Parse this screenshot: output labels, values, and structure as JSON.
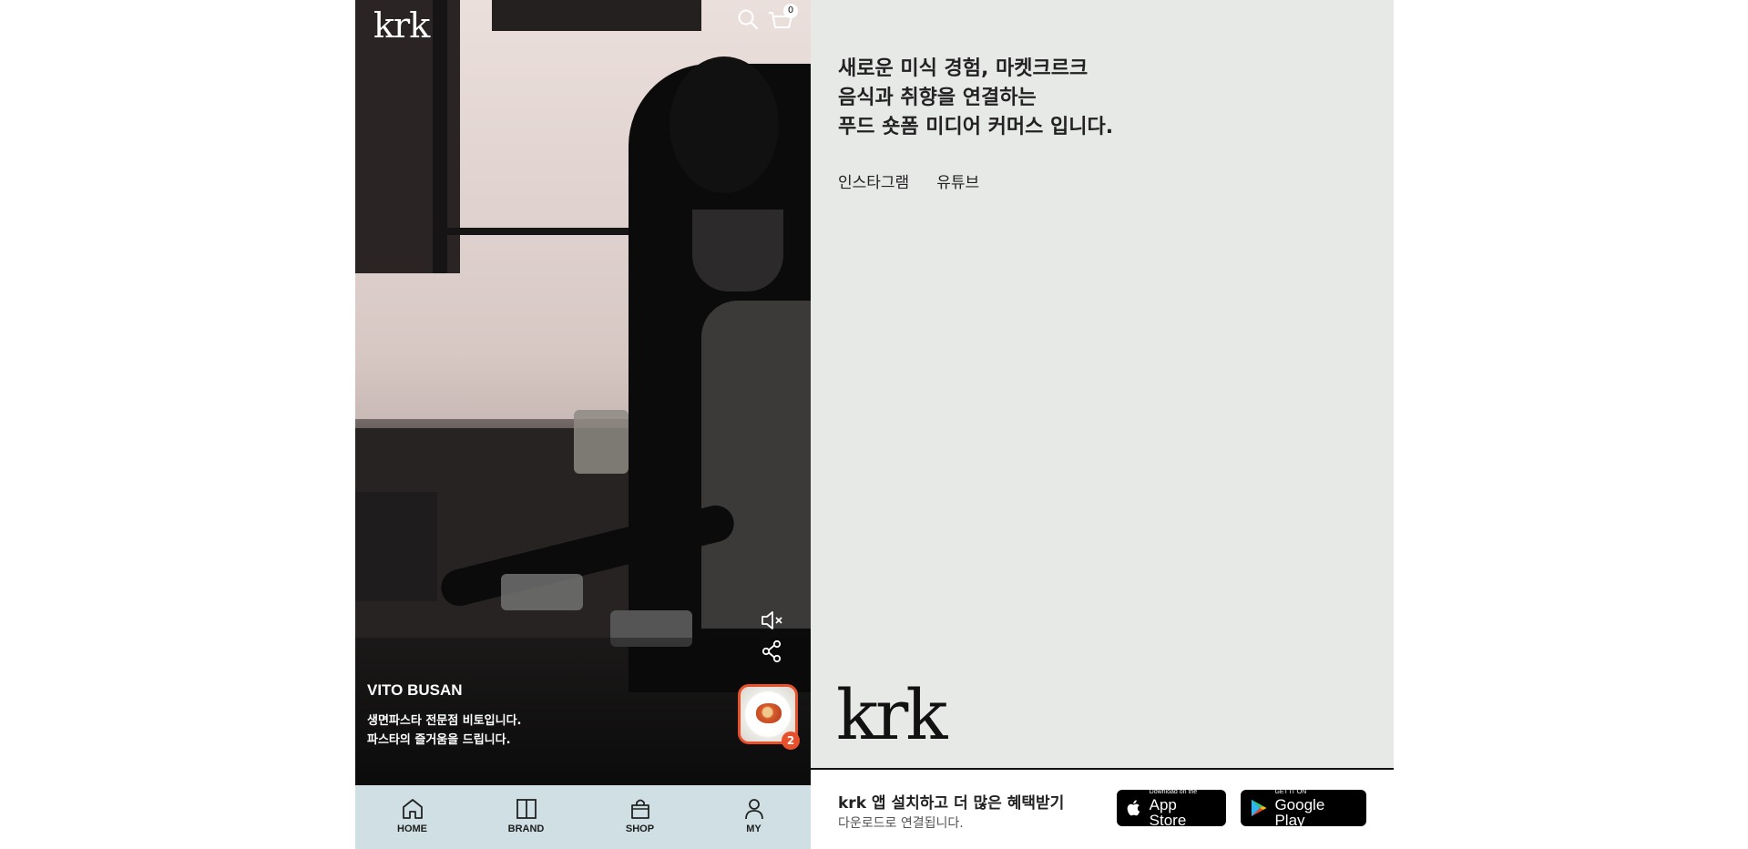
{
  "header": {
    "logo": "krk",
    "cart_count": "0"
  },
  "video": {
    "store_name": "VITO BUSAN",
    "description_line1": "생면파스타 전문점 비토입니다.",
    "description_line2": "파스타의 즐거움을 드립니다.",
    "product_count": "2"
  },
  "bottom_nav": {
    "items": [
      {
        "label": "HOME",
        "icon": "home-icon"
      },
      {
        "label": "BRAND",
        "icon": "book-icon"
      },
      {
        "label": "SHOP",
        "icon": "bag-icon"
      },
      {
        "label": "MY",
        "icon": "user-icon"
      }
    ]
  },
  "info": {
    "tagline": [
      "새로운 미식 경험, 마켓크르크",
      "음식과 취향을 연결하는",
      "푸드 숏폼 미디어 커머스 입니다."
    ],
    "social_links": [
      "인스타그램",
      "유튜브"
    ],
    "logo": "krk"
  },
  "footer": {
    "title": "krk 앱 설치하고 더 많은 혜택받기",
    "subtitle": "다운로드로 연결됩니다.",
    "app_store_small": "Download on the",
    "app_store_big": "App Store",
    "google_play_small": "GET IT ON",
    "google_play_big": "Google Play"
  },
  "colors": {
    "accent": "#e8502b",
    "nav_bg": "#cfdfe3",
    "panel_bg": "#e7e9e7"
  }
}
